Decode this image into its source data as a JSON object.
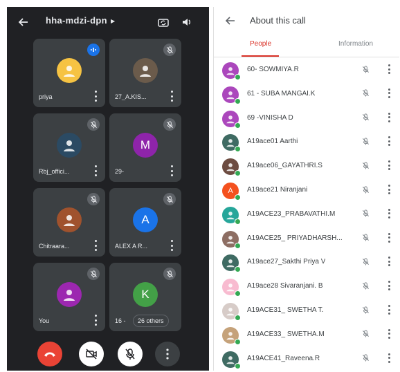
{
  "call": {
    "meeting_code": "hha-mdzi-dpn",
    "tiles": [
      {
        "name": "priya",
        "state": "speaking",
        "avatar_color": "#f6c343",
        "initial": ""
      },
      {
        "name": "27_A.KIS...",
        "state": "muted",
        "avatar_color": "#6b5b4b",
        "initial": ""
      },
      {
        "name": "Rbj_offici...",
        "state": "muted",
        "avatar_color": "#2b4a63",
        "initial": ""
      },
      {
        "name": "29-",
        "state": "muted",
        "avatar_color": "#8e24aa",
        "initial": "M"
      },
      {
        "name": "Chitraara...",
        "state": "muted",
        "avatar_color": "#a0522d",
        "initial": ""
      },
      {
        "name": "ALEX A R...",
        "state": "muted",
        "avatar_color": "#1a73e8",
        "initial": "A"
      },
      {
        "name": "You",
        "state": "muted",
        "avatar_color": "#9c27b0",
        "initial": ""
      },
      {
        "name": "16 -",
        "state": "muted",
        "avatar_color": "#43a047",
        "initial": "K",
        "others": "26 others"
      }
    ]
  },
  "panel": {
    "title": "About this call",
    "tabs": {
      "people": "People",
      "information": "Information"
    },
    "people": [
      {
        "name": "60- SOWMIYA.R",
        "avatar_color": "#ab47bc",
        "initial": ""
      },
      {
        "name": "61 - SUBA MANGAI.K",
        "avatar_color": "#ab47bc",
        "initial": ""
      },
      {
        "name": "69 -VINISHA D",
        "avatar_color": "#ab47bc",
        "initial": ""
      },
      {
        "name": "A19ace01 Aarthi",
        "avatar_color": "#3f6b63",
        "initial": ""
      },
      {
        "name": "A19ace06_GAYATHRI.S",
        "avatar_color": "#6d4c41",
        "initial": ""
      },
      {
        "name": "A19ace21 Niranjani",
        "avatar_color": "#f4511e",
        "initial": "A"
      },
      {
        "name": "A19ACE23_PRABAVATHI.M",
        "avatar_color": "#26a69a",
        "initial": ""
      },
      {
        "name": "A19ACE25_ PRIYADHARSH...",
        "avatar_color": "#8d6e63",
        "initial": ""
      },
      {
        "name": "A19ace27_Sakthi Priya V",
        "avatar_color": "#3f6b63",
        "initial": ""
      },
      {
        "name": "A19ace28 Sivaranjani. B",
        "avatar_color": "#f8bbd0",
        "initial": ""
      },
      {
        "name": "A19ACE31_ SWETHA T.",
        "avatar_color": "#d7ccc8",
        "initial": ""
      },
      {
        "name": "A19ACE33_ SWETHA.M",
        "avatar_color": "#c5a27a",
        "initial": ""
      },
      {
        "name": "A19ACE41_Raveena.R",
        "avatar_color": "#3f6b63",
        "initial": ""
      }
    ]
  }
}
